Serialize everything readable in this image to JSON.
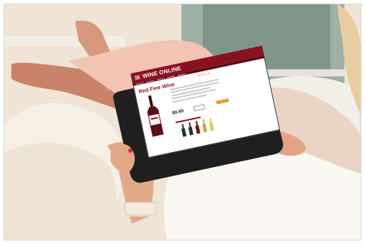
{
  "screen": {
    "brand": "WINE ONLINE",
    "product_title": "Red Fine Wine",
    "price": "$9.99",
    "rating_icon": "star-rating-icon",
    "recommended_bottle_colors": [
      "#1d3b1f",
      "#2f2f2f",
      "#6b1b10",
      "#b8b34a",
      "#d8d05a"
    ]
  },
  "colors": {
    "brand": "#8a1220",
    "button": "#e3a13a"
  }
}
